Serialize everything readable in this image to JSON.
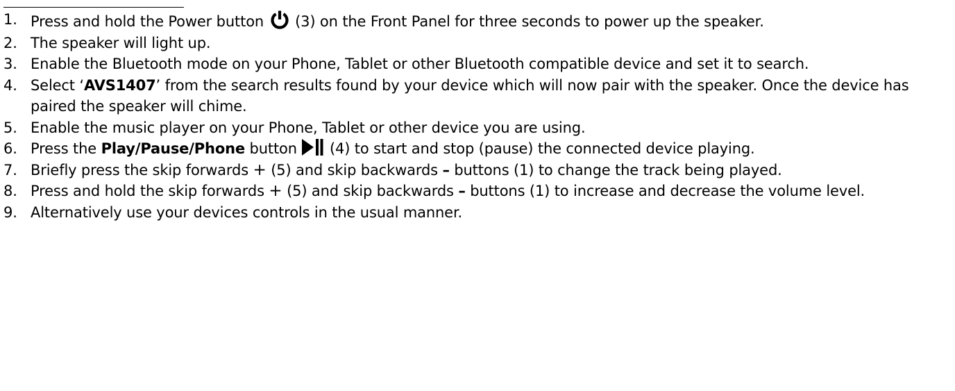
{
  "steps": [
    {
      "number": "1.",
      "text_a": "Press and hold the Power button",
      "text_b": "(3) on the Front Panel for three seconds to power up the speaker."
    },
    {
      "number": "2.",
      "text": "The speaker will light up."
    },
    {
      "number": "3.",
      "text": "Enable the Bluetooth mode on your Phone, Tablet or other Bluetooth compatible device and set it to search."
    },
    {
      "number": "4.",
      "text_a": "Select ‘",
      "bold": "AVS1407",
      "text_b": "’ from the search results found by your device which will now pair with the speaker. Once the device has paired the speaker will chime."
    },
    {
      "number": "5.",
      "text": "Enable the music player on your Phone, Tablet or other device you are using."
    },
    {
      "number": "6.",
      "text_a": "Press the",
      "bold": "Play/Pause/Phone",
      "text_b": "button",
      "text_c": "(4) to start and stop (pause) the connected device playing."
    },
    {
      "number": "7.",
      "text_a": "Briefly press the skip forwards",
      "plus": "+",
      "text_b": "(5) and skip backwards",
      "minus": "–",
      "text_c": "buttons (1) to change the track being played."
    },
    {
      "number": "8.",
      "text_a": "Press and hold the skip forwards",
      "plus": "+",
      "text_b": "(5) and skip backwards",
      "minus": "–",
      "text_c": "buttons (1) to increase and decrease the volume level."
    },
    {
      "number": "9.",
      "text": "Alternatively use your devices controls in the usual manner."
    }
  ],
  "icons": {
    "power": "power-icon",
    "play_pause": "play-pause-icon"
  },
  "colors": {
    "text": "#000000",
    "background": "#ffffff"
  }
}
